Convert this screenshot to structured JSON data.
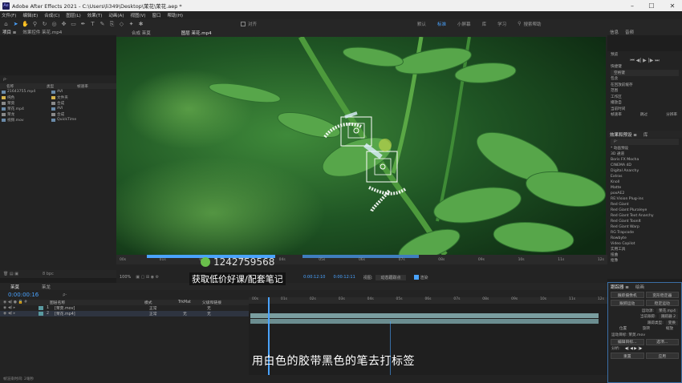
{
  "window": {
    "title": "Adobe After Effects 2021 - C:\\Users\\li349\\Desktop\\茉花\\茉花.aep *",
    "logo": "Ae"
  },
  "menu": [
    "文件(F)",
    "编辑(E)",
    "合成(C)",
    "图层(L)",
    "效果(T)",
    "动画(A)",
    "视图(V)",
    "窗口",
    "帮助(H)"
  ],
  "toolbar": {
    "align_label": "对齐",
    "workspaces": [
      "默认",
      "标准",
      "小屏幕",
      "库",
      "学习"
    ],
    "active_workspace": "标准",
    "search_placeholder": "搜索帮助"
  },
  "project": {
    "tabs": [
      "项目 ≡",
      "效果控件 茉花.mp4"
    ],
    "search_placeholder": "ρ-",
    "columns": [
      "名称",
      "类型",
      "帧速率"
    ],
    "items": [
      {
        "name": "21643755.mp4",
        "type": "AVI",
        "color": "#6a8aa8"
      },
      {
        "name": "纯色",
        "type": "文件夹",
        "color": "#d4b24a"
      },
      {
        "name": "茉莫",
        "type": "合成",
        "color": "#8a8a8a"
      },
      {
        "name": "茉花.mp4",
        "type": "AVI",
        "color": "#6a8aa8"
      },
      {
        "name": "茉龙",
        "type": "合成",
        "color": "#8a8a8a"
      },
      {
        "name": "视频.mov",
        "type": "QuickTime",
        "color": "#6a8aa8"
      }
    ],
    "bpc": "8 bpc"
  },
  "composition": {
    "tabs": [
      "合成 茉莫",
      "图层 茉花.mp4"
    ],
    "zoom": "100%",
    "timecode": "0:00:12:10",
    "timecode2": "0:00:12:11",
    "view_mode": "动态跟踪点",
    "render_label": "渲染",
    "ruler": [
      "00s",
      "01s",
      "02s",
      "03s",
      "04s",
      "05s",
      "06s",
      "07s",
      "08s",
      "09s",
      "10s",
      "11s",
      "12s"
    ]
  },
  "preview": {
    "tabs": [
      "信息",
      "音频"
    ],
    "title": "预览",
    "shortcut_label": "快捷键",
    "shortcut_value": "空格键",
    "include_label": "包含",
    "cache_label": "在回放前缓存",
    "range_label": "范围",
    "range_value": "工作区",
    "play_label": "播放自",
    "play_value": "当前时间",
    "fps_labels": [
      "帧速率",
      "跳过",
      "分辨率"
    ]
  },
  "effects": {
    "tabs": [
      "效果和预设 ≡",
      "库"
    ],
    "search_placeholder": "ρ-",
    "items": [
      "* 动画预设",
      "3D 通道",
      "Boris FX Mocha",
      "CINEMA 4D",
      "Digital Anarchy",
      "Extras",
      "Knoll",
      "Matte",
      "poxAE2",
      "RE:Vision Plug-ins",
      "Red Giant",
      "Red Giant Pluraleye",
      "Red Giant Text Anarchy",
      "Red Giant ToonIt",
      "Red Giant Warp",
      "RG Trapcode",
      "Rowbyte",
      "Video Copilot",
      "实用工具",
      "扭曲",
      "抠像"
    ]
  },
  "tracker": {
    "tabs": [
      "跟踪器 ≡",
      "绘画"
    ],
    "buttons": [
      "跟踪摄像机",
      "变形稳定器",
      "跟踪运动",
      "稳定运动"
    ],
    "source_label": "运动源:",
    "source_value": "茉花.mp4",
    "current_label": "当前跟踪:",
    "current_value": "跟踪器 2",
    "type_label": "跟踪类型:",
    "type_value": "变换",
    "checks": [
      "位置",
      "旋转",
      "缩放"
    ],
    "target_label": "运动目标: 茉莫.mov",
    "edit_button": "编辑目标...",
    "options_button": "选项...",
    "analyze_label": "分析:",
    "reset_button": "重置",
    "apply_button": "应用"
  },
  "timeline": {
    "tabs": [
      "茉莫",
      "茉龙"
    ],
    "timecode": "0:00:00:16",
    "search_placeholder": "ρ-",
    "columns": [
      "图层名称",
      "模式",
      "TrkMat",
      "父级和链接"
    ],
    "ruler": [
      "00s",
      "01s",
      "02s",
      "03s",
      "04s",
      "05s",
      "06s",
      "07s",
      "08s",
      "09s",
      "10s",
      "11s",
      "12s"
    ],
    "layers": [
      {
        "index": "1",
        "name": "[茉莫.mov]",
        "mode": "正常",
        "trk": "",
        "parent": "无"
      },
      {
        "index": "2",
        "name": "[茉花.mp4]",
        "mode": "正常",
        "trk": "无",
        "parent": "无"
      }
    ],
    "footer": "帧渲染时间: 2毫秒"
  },
  "overlay": {
    "qq": "1242759568",
    "watermark": "获取低价好课/配套笔记",
    "subtitle": "用白色的胶带黑色的笔去打标签"
  }
}
